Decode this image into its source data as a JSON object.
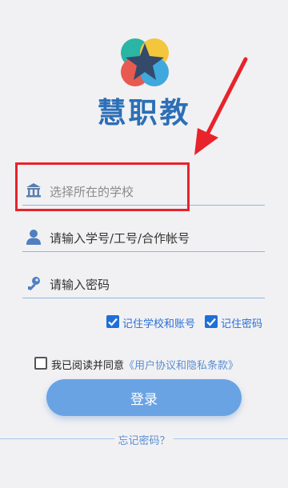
{
  "app": {
    "title": "慧职教"
  },
  "form": {
    "school_placeholder": "选择所在的学校",
    "account_placeholder": "请输入学号/工号/合作帐号",
    "password_placeholder": "请输入密码"
  },
  "options": {
    "remember_school_label": "记住学校和账号",
    "remember_school_checked": true,
    "remember_password_label": "记住密码",
    "remember_password_checked": true
  },
  "agreement": {
    "prefix": "我已阅读并同意",
    "link": "《用户协议和隐私条款》",
    "checked": false
  },
  "actions": {
    "login_label": "登录",
    "forgot_label": "忘记密码？"
  },
  "colors": {
    "accent": "#6aa3e4",
    "title": "#2c6fb6",
    "highlight": "#e8232b"
  }
}
